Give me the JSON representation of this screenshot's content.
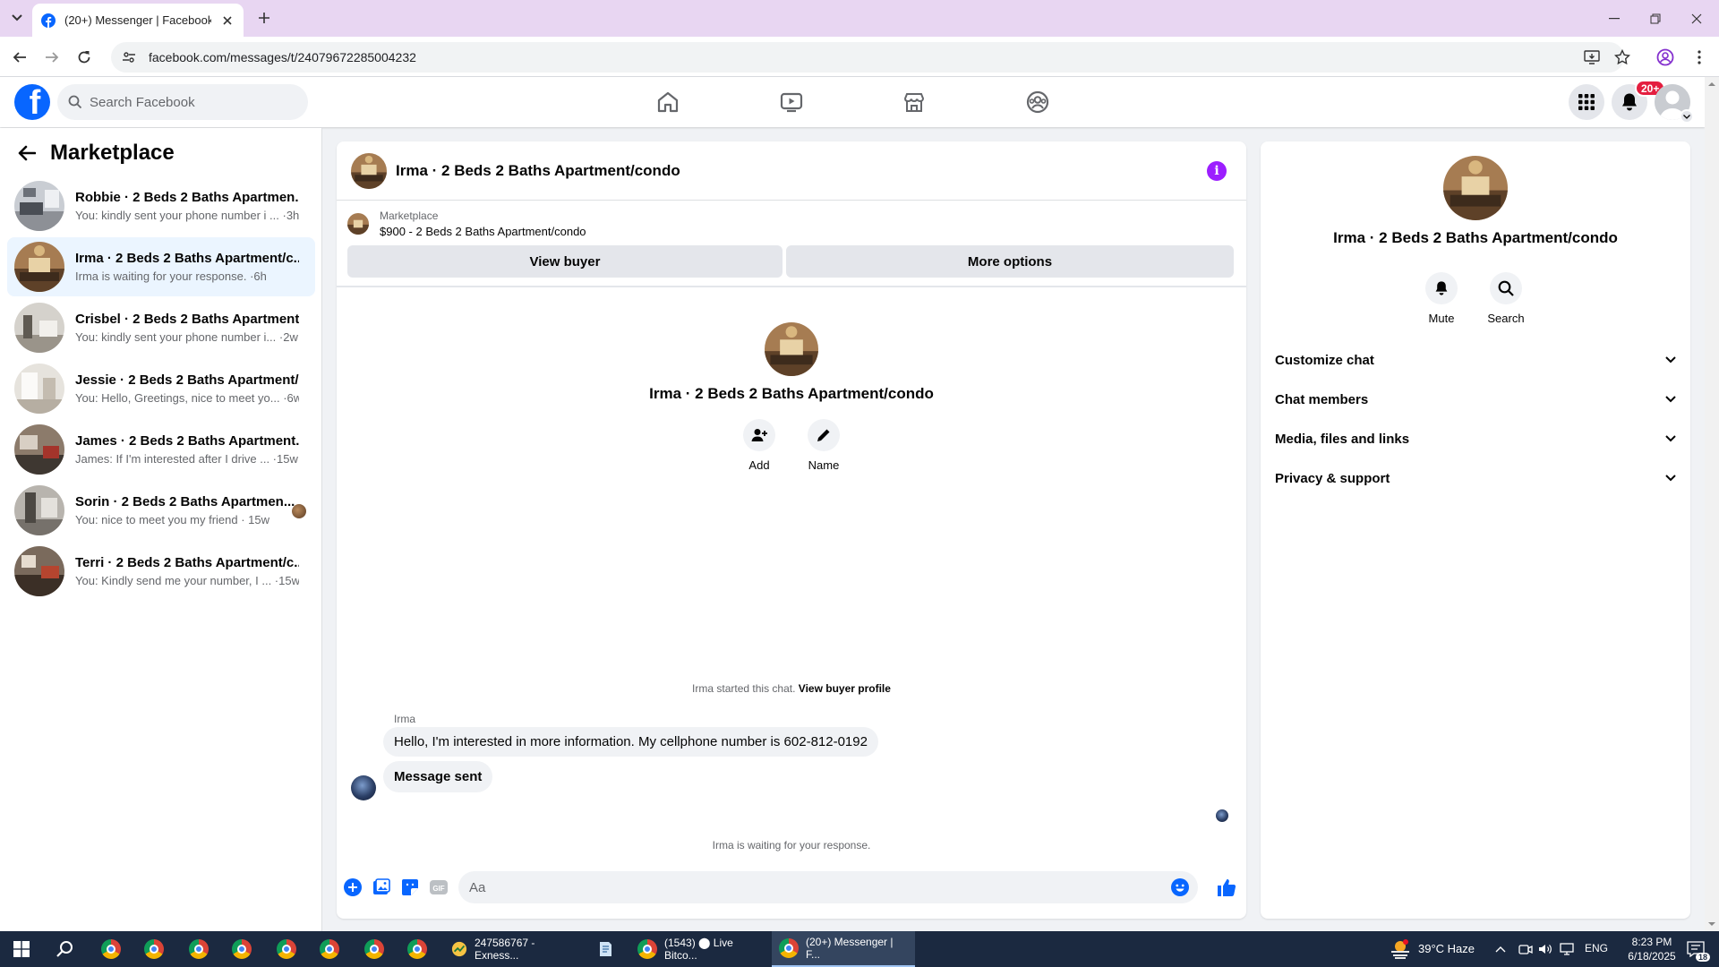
{
  "browser": {
    "tab_title": "(20+) Messenger | Facebook",
    "url": "facebook.com/messages/t/24079672285004232"
  },
  "header": {
    "search_placeholder": "Search Facebook",
    "notification_badge": "20+"
  },
  "sidebar": {
    "title": "Marketplace",
    "conversations": [
      {
        "name": "Robbie · 2 Beds 2 Baths Apartmen...",
        "preview": "You: kindly sent your phone number i ... ·3h",
        "active": false
      },
      {
        "name": "Irma · 2 Beds 2 Baths Apartment/c...",
        "preview": "Irma is waiting for your response. ·6h",
        "active": true
      },
      {
        "name": "Crisbel · 2 Beds 2 Baths Apartment...",
        "preview": "You: kindly sent your phone number i... ·2w",
        "active": false
      },
      {
        "name": "Jessie · 2 Beds 2 Baths Apartment/...",
        "preview": "You: Hello, Greetings, nice to meet yo... ·6w",
        "active": false
      },
      {
        "name": "James · 2 Beds 2 Baths Apartment...",
        "preview": "James: If I'm interested after I drive ... ·15w",
        "active": false
      },
      {
        "name": "Sorin · 2 Beds 2 Baths Apartmen...",
        "preview": "You: nice to meet you my friend · 15w",
        "active": false
      },
      {
        "name": "Terri · 2 Beds 2 Baths Apartment/c...",
        "preview": "You: Kindly send me your number, I ... ·15w",
        "active": false
      }
    ]
  },
  "chat": {
    "title": "Irma · 2 Beds 2 Baths Apartment/condo",
    "marketplace_label": "Marketplace",
    "listing": "$900 - 2 Beds 2 Baths Apartment/condo",
    "view_buyer_label": "View buyer",
    "more_options_label": "More options",
    "intro_name": "Irma · 2 Beds 2 Baths Apartment/condo",
    "add_label": "Add",
    "name_label": "Name",
    "started_text": "Irma started this chat.",
    "view_profile_label": "View buyer profile",
    "sender": "Irma",
    "message_1": "Hello, I'm interested in more information. My cellphone number is 602-812-0192",
    "message_2": "Message sent",
    "waiting_text": "Irma is waiting for your response.",
    "composer_placeholder": "Aa"
  },
  "details": {
    "name": "Irma · 2 Beds 2 Baths Apartment/condo",
    "mute_label": "Mute",
    "search_label": "Search",
    "sections": [
      "Customize chat",
      "Chat members",
      "Media, files and links",
      "Privacy & support"
    ]
  },
  "taskbar": {
    "exness_label": "247586767 - Exness...",
    "bitcoin_label": "(1543) ⬤ Live Bitco...",
    "messenger_label": "(20+) Messenger | F...",
    "weather": "39°C  Haze",
    "language": "ENG",
    "time": "8:23 PM",
    "date": "6/18/2025",
    "notifications": "18"
  },
  "colors": {
    "fb_blue": "#0866ff",
    "messenger_purple": "#9c1eff",
    "active_row": "#ebf5ff"
  }
}
